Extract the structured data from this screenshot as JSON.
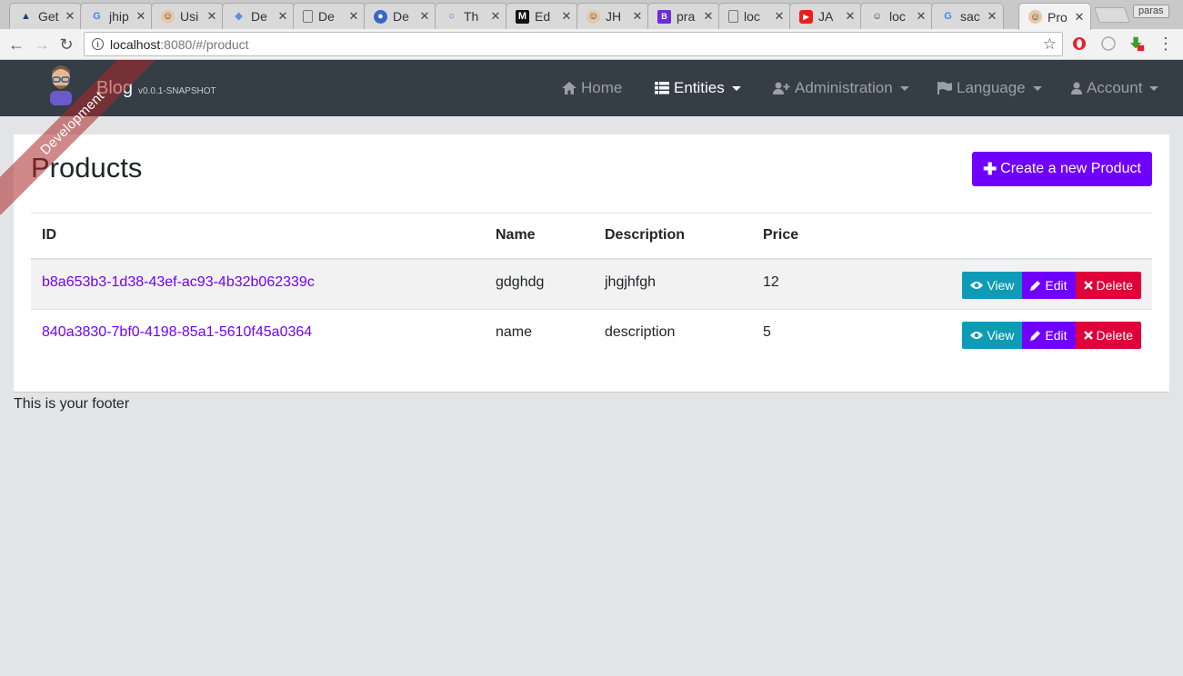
{
  "browser": {
    "tabs": [
      {
        "label": "Get",
        "icon": "atlassian-icon"
      },
      {
        "label": "jhip",
        "icon": "google-icon"
      },
      {
        "label": "Usi",
        "icon": "jhipster-icon"
      },
      {
        "label": "De",
        "icon": "webpack-icon"
      },
      {
        "label": "De",
        "icon": "page-icon"
      },
      {
        "label": "De",
        "icon": "circle-icon"
      },
      {
        "label": "Th",
        "icon": "ring-icon"
      },
      {
        "label": "Ed",
        "icon": "medium-icon"
      },
      {
        "label": "JH",
        "icon": "jhipster-icon"
      },
      {
        "label": "pra",
        "icon": "bootstrap-icon"
      },
      {
        "label": "loc",
        "icon": "page-icon"
      },
      {
        "label": "JA",
        "icon": "youtube-icon"
      },
      {
        "label": "loc",
        "icon": "jhipster-icon"
      },
      {
        "label": "sac",
        "icon": "google-icon"
      },
      {
        "label": "Pro",
        "icon": "jhipster-icon"
      }
    ],
    "profile_name": "paras",
    "url_host": "localhost",
    "url_path": ":8080/#/product"
  },
  "navbar": {
    "brand_title": "Blog",
    "brand_version": "v0.0.1-SNAPSHOT",
    "ribbon": "Development",
    "items": {
      "home": "Home",
      "entities": "Entities",
      "administration": "Administration",
      "language": "Language",
      "account": "Account"
    }
  },
  "page": {
    "title": "Products",
    "create_label": "Create a new Product"
  },
  "table": {
    "headers": {
      "id": "ID",
      "name": "Name",
      "description": "Description",
      "price": "Price"
    },
    "rows": [
      {
        "id": "b8a653b3-1d38-43ef-ac93-4b32b062339c",
        "name": "gdghdg",
        "description": "jhgjhfgh",
        "price": "12"
      },
      {
        "id": "840a3830-7bf0-4198-85a1-5610f45a0364",
        "name": "name",
        "description": "description",
        "price": "5"
      }
    ],
    "actions": {
      "view": "View",
      "edit": "Edit",
      "delete": "Delete"
    }
  },
  "footer": "This is your footer",
  "colors": {
    "primary": "#6f00ff",
    "info": "#0d9bb5",
    "danger": "#e0003a",
    "navbar": "#353d47"
  }
}
